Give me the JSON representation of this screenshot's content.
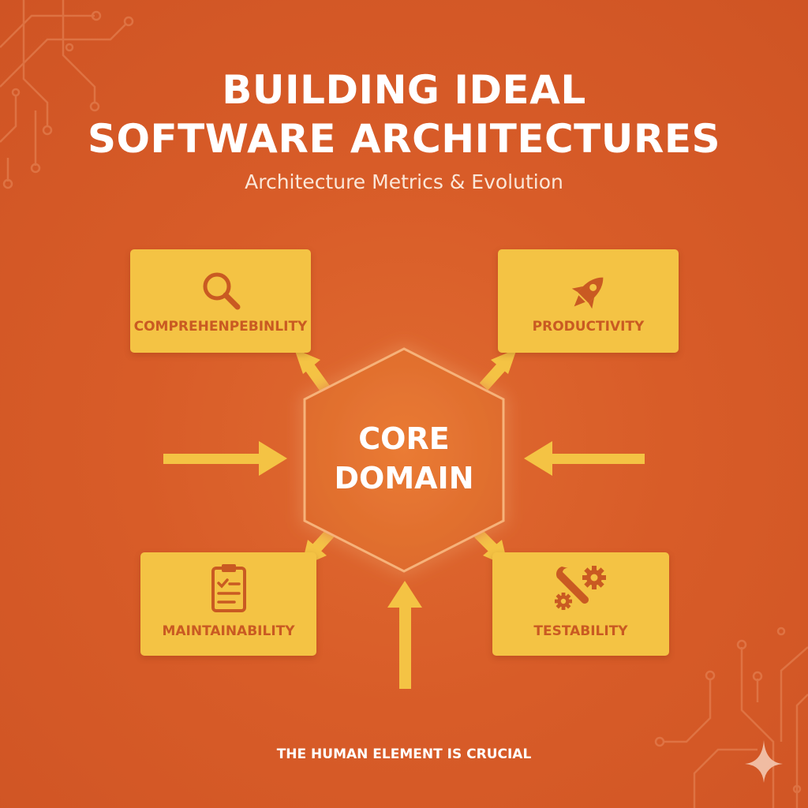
{
  "title": {
    "line1": "BUILDING IDEAL",
    "line2": "SOFTWARE ARCHITECTURES"
  },
  "subtitle": "Architecture Metrics & Evolution",
  "core": {
    "line1": "CORE",
    "line2": "DOMAIN"
  },
  "cards": {
    "comprehensibility": {
      "label": "COMPREHENPEBINLITY",
      "icon": "magnifier-icon"
    },
    "productivity": {
      "label": "PRODUCTIVITY",
      "icon": "rocket-icon"
    },
    "maintainability": {
      "label": "MAINTAINABILITY",
      "icon": "clipboard-checklist-icon"
    },
    "testability": {
      "label": "TESTABILITY",
      "icon": "wrench-gears-icon"
    }
  },
  "footer": "THE HUMAN ELEMENT IS CRUCIAL",
  "colors": {
    "background": "#D85A27",
    "card": "#F4C344",
    "card_text": "#C95A22",
    "hexagon": "#E2722F",
    "arrow": "#F4C344",
    "text": "#FFFFFF"
  }
}
